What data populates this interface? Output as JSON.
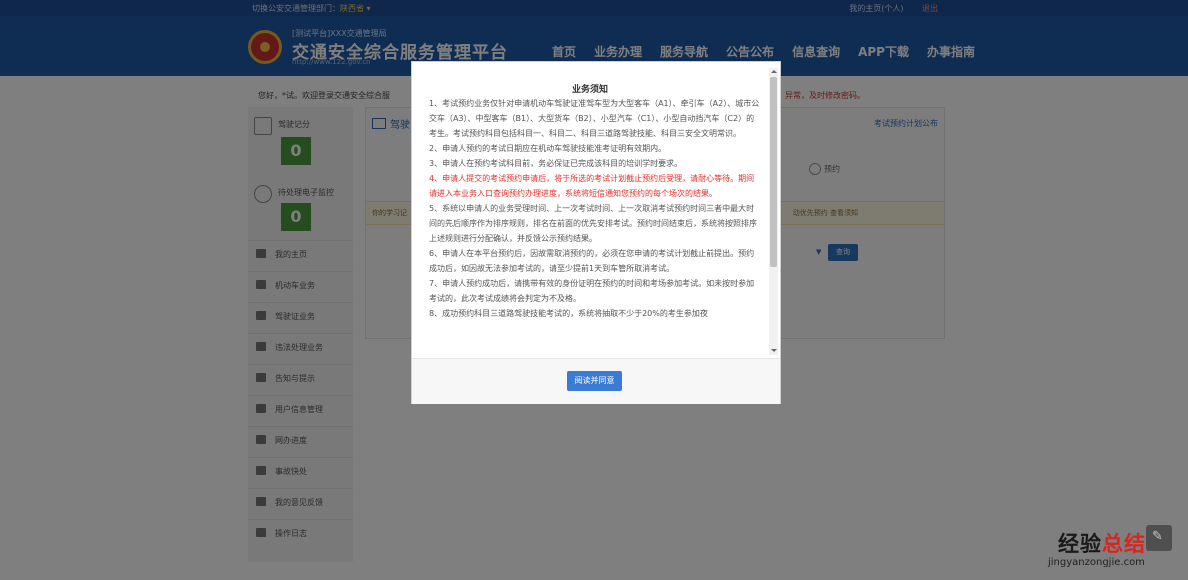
{
  "topbar": {
    "switch_label": "切换公安交通管理部门：",
    "region": "陕西省 ▾",
    "my_home": "我的主页(个人)",
    "logout": "退出"
  },
  "header": {
    "platform_small": "[测试平台]XXX交通管理局",
    "title": "交通安全综合服务管理平台",
    "url": "http://www.122.gov.cn",
    "nav": [
      "首页",
      "业务办理",
      "服务导航",
      "公告公布",
      "信息查询",
      "APP下载",
      "办事指南"
    ]
  },
  "welcome": {
    "text": "您好，*试。欢迎登录交通安全综合服",
    "right": "异常，及时修改密码。"
  },
  "sidebar": {
    "score_label": "驾驶记分",
    "score_value": "0",
    "monitor_label": "待处理电子监控",
    "monitor_value": "0",
    "items": [
      "我的主页",
      "机动车业务",
      "驾驶证业务",
      "违法处理业务",
      "告知与提示",
      "用户信息管理",
      "网办进度",
      "事故快处",
      "我的意见反馈",
      "操作日志"
    ]
  },
  "main": {
    "tab_title": "驾驶",
    "tab_right": "考试预约计划公布",
    "step_label": "预约",
    "notice_left": "你的学习记",
    "notice_right": "动优先预约 查看须知",
    "query_button": "查询"
  },
  "modal": {
    "title": "业务须知",
    "terms": [
      {
        "text": "1、考试预约业务仅针对申请机动车驾驶证准驾车型为大型客车（A1）、牵引车（A2）、城市公交车（A3）、中型客车（B1）、大型货车（B2）、小型汽车（C1）、小型自动挡汽车（C2）的考生。考试预约科目包括科目一、科目二、科目三道路驾驶技能、科目三安全文明常识。",
        "red": false
      },
      {
        "text": "2、申请人预约的考试日期应在机动车驾驶技能准考证明有效期内。",
        "red": false
      },
      {
        "text": "3、申请人在预约考试科目前，务必保证已完成该科目的培训学时要求。",
        "red": false
      },
      {
        "text": "4、申请人提交的考试预约申请后，将于所选的考试计划截止预约后受理，请耐心等待。期间请进入本业务入口查询预约办理进度，系统将短信通知您预约的每个场次的结果。",
        "red": true
      },
      {
        "text": "5、系统以申请人的业务受理时间、上一次考试时间、上一次取消考试预约时间三者中最大时间的先后顺序作为排序规则，排名在前面的优先安排考试。预约时间结束后，系统将按照排序上述规则进行分配确认，并反馈公示预约结果。",
        "red": false
      },
      {
        "text": "6、申请人在本平台预约后，因故需取消预约的，必须在您申请的考试计划截止前提出。预约成功后，如因故无法参加考试的，请至少提前1天到车管所取消考试。",
        "red": false
      },
      {
        "text": "7、申请人预约成功后，请携带有效的身份证明在预约的时间和考场参加考试。如未按时参加考试的，此次考试成绩将会判定为不及格。",
        "red": false
      },
      {
        "text": "8、成功预约科目三道路驾驶技能考试的，系统将抽取不少于20%的考生参加夜",
        "red": false
      }
    ],
    "agree_button": "阅读并同意"
  },
  "watermark": {
    "main_a": "经验",
    "main_b": "总结",
    "sub": "jingyanzongjie.com",
    "icon_glyph": "✎"
  }
}
